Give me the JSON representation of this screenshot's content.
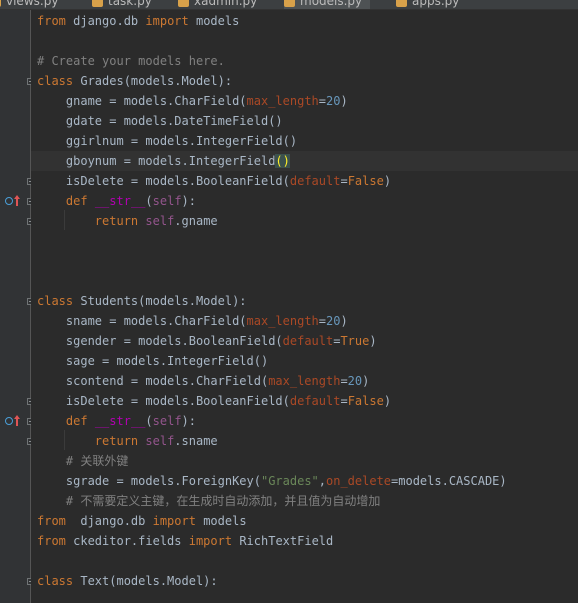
{
  "tabs": [
    {
      "label": "views.py",
      "active": false
    },
    {
      "label": "task.py",
      "active": false
    },
    {
      "label": "xadmin.py",
      "active": false
    },
    {
      "label": "models.py",
      "active": true
    },
    {
      "label": "apps.py",
      "active": false
    }
  ],
  "code": [
    [
      {
        "t": "from",
        "c": "kw"
      },
      {
        "t": " django.db "
      },
      {
        "t": "import",
        "c": "kw"
      },
      {
        "t": " models"
      }
    ],
    [],
    [
      {
        "t": "# Create your models here.",
        "c": "cm"
      }
    ],
    [
      {
        "t": "class",
        "c": "kw"
      },
      {
        "t": " Grades(models.Model):"
      }
    ],
    [
      {
        "t": "    gname = models.CharField("
      },
      {
        "t": "max_length",
        "c": "pm"
      },
      {
        "t": "="
      },
      {
        "t": "20",
        "c": "num"
      },
      {
        "t": ")"
      }
    ],
    [
      {
        "t": "    gdate = models.DateTimeField()"
      }
    ],
    [
      {
        "t": "    ggirlnum = models.IntegerField()"
      }
    ],
    [
      {
        "t": "    gboynum = models.IntegerField"
      },
      {
        "t": "()",
        "c": "hl"
      }
    ],
    [
      {
        "t": "    isDelete = models.BooleanField("
      },
      {
        "t": "default",
        "c": "pm"
      },
      {
        "t": "="
      },
      {
        "t": "False",
        "c": "kw"
      },
      {
        "t": ")"
      }
    ],
    [
      {
        "t": "    "
      },
      {
        "t": "def",
        "c": "kw"
      },
      {
        "t": " "
      },
      {
        "t": "__str__",
        "c": "dn"
      },
      {
        "t": "("
      },
      {
        "t": "self",
        "c": "slf"
      },
      {
        "t": "):"
      }
    ],
    [
      {
        "t": "        "
      },
      {
        "t": "return",
        "c": "kw"
      },
      {
        "t": " "
      },
      {
        "t": "self",
        "c": "slf"
      },
      {
        "t": ".gname"
      }
    ],
    [],
    [],
    [],
    [
      {
        "t": "class",
        "c": "kw"
      },
      {
        "t": " Students(models.Model):"
      }
    ],
    [
      {
        "t": "    sname = models.CharField("
      },
      {
        "t": "max_length",
        "c": "pm"
      },
      {
        "t": "="
      },
      {
        "t": "20",
        "c": "num"
      },
      {
        "t": ")"
      }
    ],
    [
      {
        "t": "    sgender = models.BooleanField("
      },
      {
        "t": "default",
        "c": "pm"
      },
      {
        "t": "="
      },
      {
        "t": "True",
        "c": "kw"
      },
      {
        "t": ")"
      }
    ],
    [
      {
        "t": "    sage = models.IntegerField()"
      }
    ],
    [
      {
        "t": "    scontend = models.CharField("
      },
      {
        "t": "max_length",
        "c": "pm"
      },
      {
        "t": "="
      },
      {
        "t": "20",
        "c": "num"
      },
      {
        "t": ")"
      }
    ],
    [
      {
        "t": "    isDelete = models.BooleanField("
      },
      {
        "t": "default",
        "c": "pm"
      },
      {
        "t": "="
      },
      {
        "t": "False",
        "c": "kw"
      },
      {
        "t": ")"
      }
    ],
    [
      {
        "t": "    "
      },
      {
        "t": "def",
        "c": "kw"
      },
      {
        "t": " "
      },
      {
        "t": "__str__",
        "c": "dn"
      },
      {
        "t": "("
      },
      {
        "t": "self",
        "c": "slf"
      },
      {
        "t": "):"
      }
    ],
    [
      {
        "t": "        "
      },
      {
        "t": "return",
        "c": "kw"
      },
      {
        "t": " "
      },
      {
        "t": "self",
        "c": "slf"
      },
      {
        "t": ".sname"
      }
    ],
    [
      {
        "t": "    # 关联外键",
        "c": "cm"
      }
    ],
    [
      {
        "t": "    sgrade = models.ForeignKey("
      },
      {
        "t": "\"Grades\"",
        "c": "str"
      },
      {
        "t": ","
      },
      {
        "t": "on_delete",
        "c": "pm"
      },
      {
        "t": "=models.CASCADE)"
      }
    ],
    [
      {
        "t": "    # 不需要定义主键，在生成时自动添加，并且值为自动增加",
        "c": "cm"
      }
    ],
    [
      {
        "t": "from",
        "c": "kw"
      },
      {
        "t": "  django.db "
      },
      {
        "t": "import",
        "c": "kw"
      },
      {
        "t": " models"
      }
    ],
    [
      {
        "t": "from",
        "c": "kw"
      },
      {
        "t": " ckeditor.fields "
      },
      {
        "t": "import",
        "c": "kw"
      },
      {
        "t": " RichTextField"
      }
    ],
    [],
    [
      {
        "t": "class",
        "c": "kw"
      },
      {
        "t": " Text(models.Model):"
      }
    ],
    []
  ],
  "current_line": 8,
  "colors": {
    "background": "#2b2b2b",
    "keyword": "#cc7832",
    "comment": "#808080",
    "string": "#6a8759",
    "param": "#aa4926",
    "number": "#6897bb",
    "dunder": "#b200b2",
    "self": "#94558d"
  },
  "gutter_icons": [
    {
      "line": 10,
      "icon": "override-method-icon"
    },
    {
      "line": 21,
      "icon": "override-method-icon"
    }
  ],
  "fold_markers": [
    4,
    9,
    10,
    11,
    15,
    20,
    21,
    22,
    29
  ]
}
